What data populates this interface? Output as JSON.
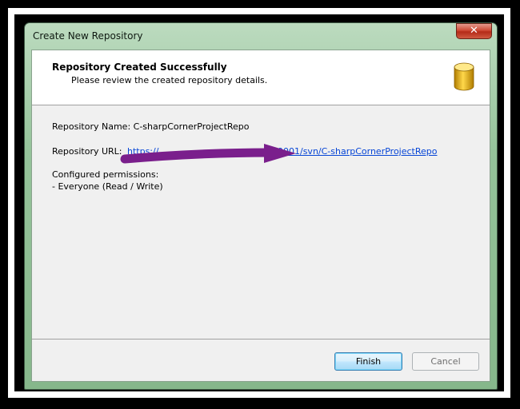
{
  "window": {
    "title": "Create New Repository",
    "close_glyph": "✕"
  },
  "header": {
    "title": "Repository Created Successfully",
    "subtitle": "Please review the created repository details.",
    "icon": "database-icon"
  },
  "details": {
    "name_label": "Repository Name:",
    "name_value": "C-sharpCornerProjectRepo",
    "url_label": "Repository URL:",
    "url_visible_start": "https://",
    "url_visible_end": "9001/svn/C-sharpCornerProjectRepo",
    "permissions_label": "Configured permissions:",
    "permissions_value": "- Everyone (Read / Write)"
  },
  "buttons": {
    "finish": "Finish",
    "cancel": "Cancel"
  },
  "colors": {
    "link": "#0645d6",
    "arrow": "#7a1f8c",
    "titlebar": "#95c39a"
  }
}
